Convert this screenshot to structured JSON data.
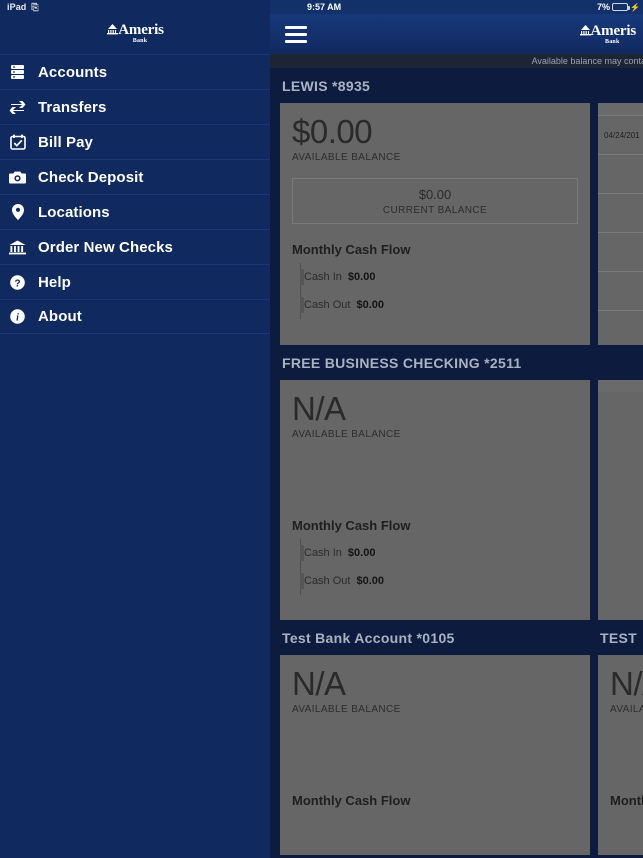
{
  "status_bar": {
    "device_label": "iPad",
    "rotation_icon": "rotation-lock-icon",
    "time": "9:57 AM",
    "battery_percent": "7%",
    "battery_level": 7,
    "battery_color": "#e02d2d",
    "charging_icon": "lightning-bolt-icon"
  },
  "brand": {
    "name": "Ameris",
    "sub": "Bank",
    "logo_icon": "ameris-bank-logo"
  },
  "sidebar": {
    "background": "#10295e",
    "items": [
      {
        "label": "Accounts",
        "icon": "accounts-stack-icon"
      },
      {
        "label": "Transfers",
        "icon": "transfer-arrows-icon"
      },
      {
        "label": "Bill Pay",
        "icon": "calendar-check-icon"
      },
      {
        "label": "Check Deposit",
        "icon": "camera-icon"
      },
      {
        "label": "Locations",
        "icon": "map-pin-icon"
      },
      {
        "label": "Order New Checks",
        "icon": "bank-building-icon"
      },
      {
        "label": "Help",
        "icon": "question-circle-icon"
      },
      {
        "label": "About",
        "icon": "info-circle-icon"
      }
    ]
  },
  "navbar": {
    "menu_icon": "hamburger-menu-icon"
  },
  "notice": {
    "text": "Available balance may contain Overdraft"
  },
  "labels": {
    "available_balance": "AVAILABLE BALANCE",
    "current_balance": "CURRENT BALANCE",
    "monthly_cash_flow": "Monthly Cash Flow",
    "cash_in": "Cash In",
    "cash_out": "Cash Out"
  },
  "accounts": [
    {
      "title": "LEWIS *8935",
      "available_balance": "$0.00",
      "current_balance": "$0.00",
      "has_current_balance": true,
      "cash_in": "$0.00",
      "cash_out": "$0.00",
      "transactions": [
        {
          "date": "04/24/201"
        },
        {
          "date": ""
        },
        {
          "date": ""
        },
        {
          "date": ""
        },
        {
          "date": ""
        },
        {
          "date": ""
        }
      ]
    },
    {
      "title": "FREE BUSINESS CHECKING *2511",
      "available_balance": "N/A",
      "current_balance": "",
      "has_current_balance": false,
      "cash_in": "$0.00",
      "cash_out": "$0.00",
      "transactions": []
    },
    {
      "title": "Test Bank Account  *0105",
      "available_balance": "N/A",
      "current_balance": "",
      "has_current_balance": false,
      "cash_in": "",
      "cash_out": "",
      "transactions": []
    },
    {
      "title": "TEST",
      "available_balance": "N/A",
      "current_balance": "",
      "has_current_balance": false,
      "cash_in": "",
      "cash_out": "",
      "transactions": []
    }
  ],
  "colors": {
    "sidebar_blue": "#10295e",
    "content_navy": "#0d1b3e",
    "card_gray": "#666666",
    "notice_dark": "#1d2433",
    "title_gray": "#aab2c2"
  }
}
